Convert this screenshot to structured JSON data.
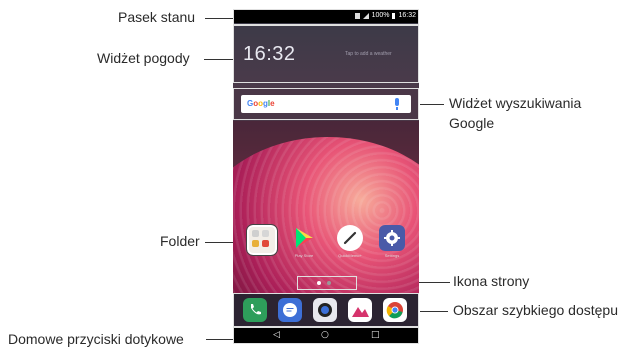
{
  "labels": {
    "status_bar": "Pasek stanu",
    "weather_widget": "Widżet pogody",
    "google_widget_line1": "Widżet wyszukiwania",
    "google_widget_line2": "Google",
    "folder": "Folder",
    "page_icon": "Ikona strony",
    "quick_access": "Obszar szybkiego dostępu",
    "home_touch_buttons": "Domowe przyciski dotykowe"
  },
  "phone": {
    "status_bar": {
      "battery": "100%",
      "time": "16:32"
    },
    "weather": {
      "clock": "16:32",
      "hint": "Tap to add a weather"
    },
    "search": {
      "logo": "Google"
    },
    "apps": [
      {
        "name": "folder-icon",
        "label": ""
      },
      {
        "name": "play-store-icon",
        "label": "Play Store"
      },
      {
        "name": "quickmemo-icon",
        "label": "QuickMemo+"
      },
      {
        "name": "settings-icon",
        "label": "Settings"
      }
    ],
    "dock": [
      "phone-icon",
      "messages-icon",
      "camera-icon",
      "gallery-icon",
      "chrome-icon"
    ],
    "nav": {
      "back": "◁",
      "home": "○",
      "recents": "□"
    }
  },
  "colors": {
    "accent": "#d81b60",
    "google_blue": "#4285f4",
    "leader": "#333333"
  }
}
